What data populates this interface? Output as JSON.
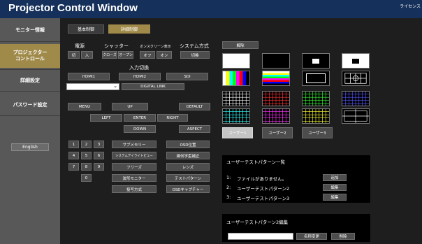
{
  "app": {
    "title": "Projector Control Window",
    "license": "ライセンス"
  },
  "sidebar": {
    "items": [
      {
        "label": "モニター情報"
      },
      {
        "label": "プロジェクター\nコントロール"
      },
      {
        "label": "詳細設定"
      },
      {
        "label": "パスワード設定"
      }
    ],
    "language_button": "English"
  },
  "tabs": {
    "basic": "基本制御",
    "advanced": "詳細制御"
  },
  "power": {
    "label": "電源",
    "off": "切",
    "on": "入"
  },
  "shutter": {
    "label": "シャッター",
    "close": "クローズ",
    "open": "オープン"
  },
  "onscreen": {
    "label": "オンスクリーン表示",
    "off": "オフ",
    "on": "オン"
  },
  "system": {
    "label": "システム方式",
    "switch": "切換"
  },
  "input": {
    "label": "入力切換",
    "hdmi1": "HDMI1",
    "hdmi2": "HDMI2",
    "sdi": "SDI",
    "digital_link": "DIGITAL LINK",
    "select_value": ""
  },
  "nav": {
    "menu": "MENU",
    "up": "UP",
    "default": "DEFAULT",
    "left": "LEFT",
    "enter": "ENTER",
    "right": "RIGHT",
    "down": "DOWN",
    "aspect": "ASPECT"
  },
  "numpad": [
    "1",
    "2",
    "3",
    "4",
    "5",
    "6",
    "7",
    "8",
    "9",
    "0"
  ],
  "functions": {
    "sub_memory": "サブメモリー",
    "osd_position": "OSD位置",
    "system_daylight": "システムデイライトビュー",
    "geometry": "幾何学歪補正",
    "freeze": "フリーズ",
    "lens": "レンズ",
    "waveform": "波形モニター",
    "test_pattern": "テストパターン",
    "projection": "投写方式",
    "osd_capture": "OSDキャプチャー"
  },
  "patterns": {
    "release": "解除",
    "user1": "ユーザー1",
    "user2": "ユーザー2",
    "user3": "ユーザー3"
  },
  "user_list": {
    "title": "ユーザーテストパターン一覧",
    "rows": [
      {
        "index": "1:",
        "name": "ファイルがありません。",
        "action": "追加"
      },
      {
        "index": "2:",
        "name": "ユーザーテストパターン2",
        "action": "編集"
      },
      {
        "index": "3:",
        "name": "ユーザーテストパターン3",
        "action": "編集"
      }
    ]
  },
  "edit_panel": {
    "title": "ユーザーテストパターン2編集",
    "input_value": "",
    "rename": "名称変更",
    "delete": "削除"
  },
  "colors": {
    "titlebar": "#15305a",
    "sidebar": "#585858",
    "active": "#a08a4a",
    "main": "#1e1e1e"
  }
}
